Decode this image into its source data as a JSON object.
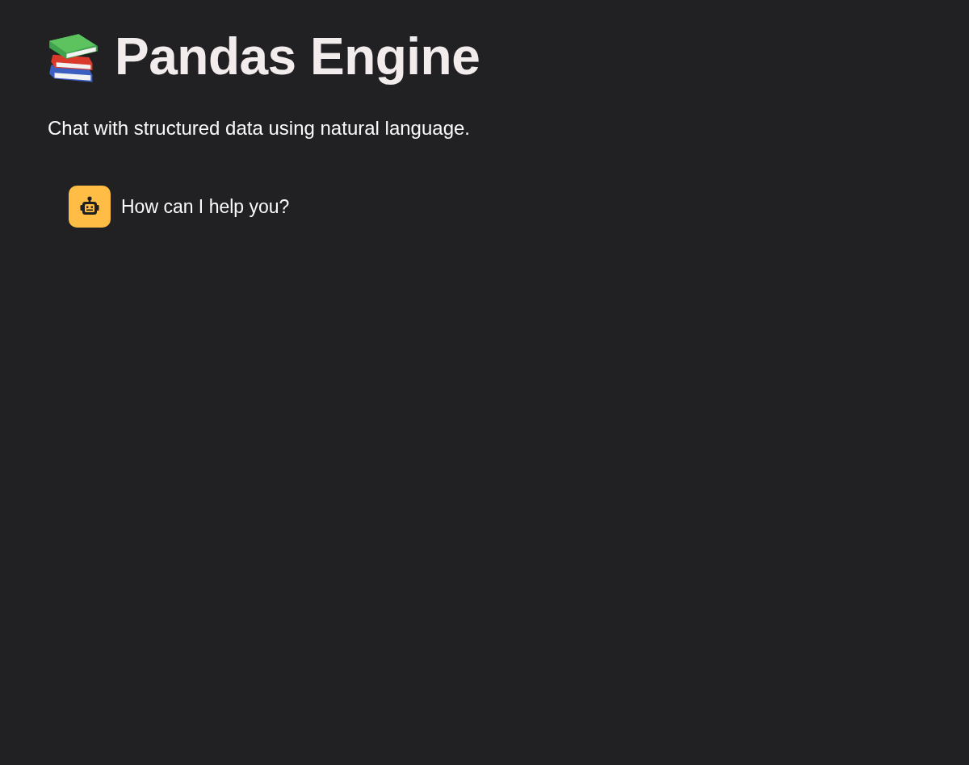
{
  "header": {
    "title": "Pandas Engine",
    "subtitle": "Chat with structured data using natural language."
  },
  "messages": [
    {
      "kind": "assistant",
      "text": "How can I help you?"
    }
  ]
}
